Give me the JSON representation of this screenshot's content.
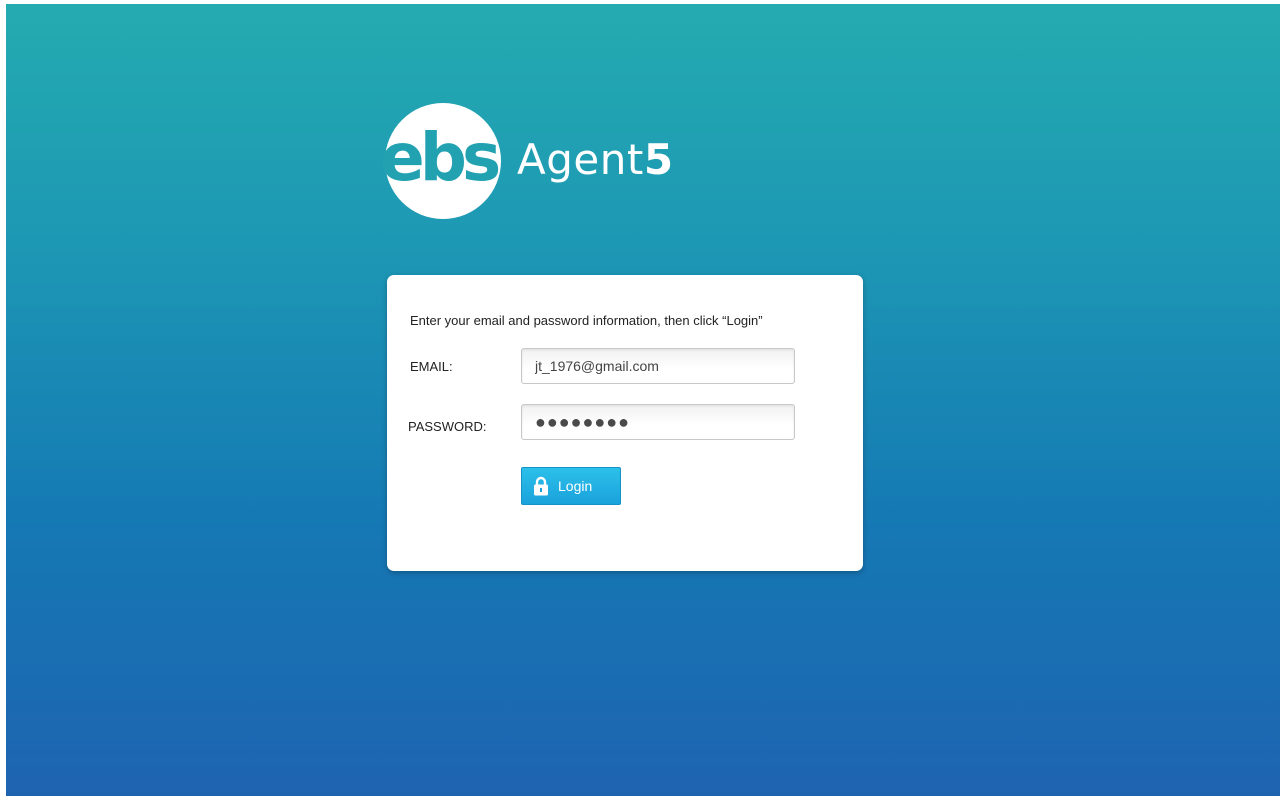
{
  "brand": {
    "mark": "ebs",
    "product": "Agent",
    "product_number": "5"
  },
  "login_form": {
    "instructions": "Enter your email and password information, then click “Login”",
    "email_label": "EMAIL:",
    "email_value": "jt_1976@gmail.com",
    "password_label": "PASSWORD:",
    "password_value": "●●●●●●●●",
    "login_label": "Login"
  },
  "icons": {
    "login_button_icon": "lock-icon"
  },
  "colors": {
    "background_top": "#24abb0",
    "background_bottom": "#1e63b0",
    "button": "#1aa2dc",
    "logo_mark": "#22a2b1"
  }
}
